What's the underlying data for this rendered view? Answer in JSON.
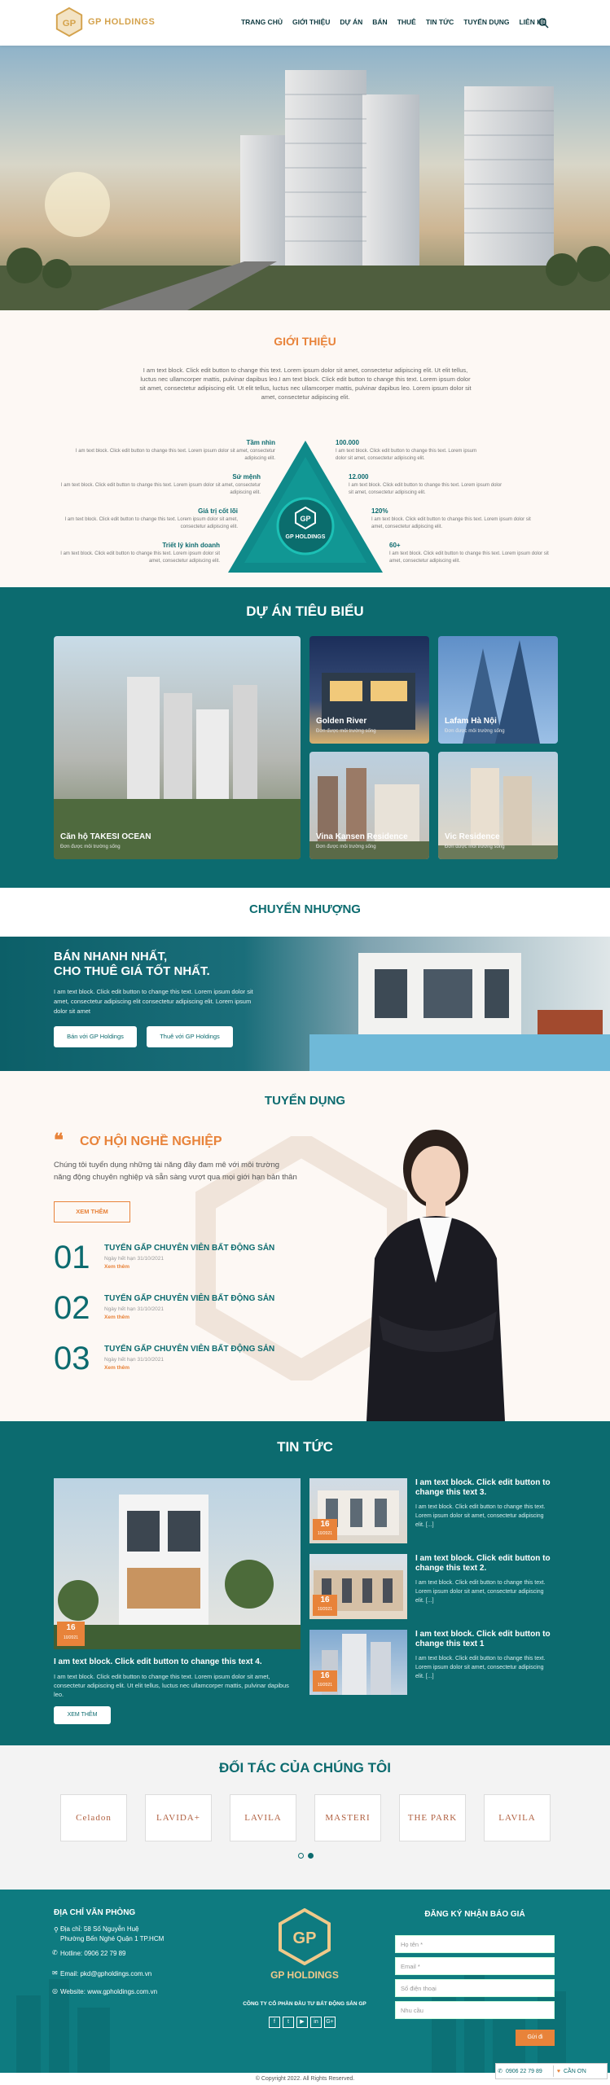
{
  "header": {
    "logo_text": "GP HOLDINGS",
    "nav": [
      "TRANG CHỦ",
      "GIỚI THIỆU",
      "DỰ ÁN",
      "BÁN",
      "THUÊ",
      "TIN TỨC",
      "TUYỂN DỤNG",
      "LIÊN HỆ"
    ]
  },
  "intro": {
    "title": "GIỚI THIỆU",
    "text": "I am text block. Click edit button to change this text. Lorem ipsum dolor sit amet, consectetur adipiscing elit. Ut elit tellus, luctus nec ullamcorper mattis, pulvinar dapibus leo.I am text block. Click edit button to change this text. Lorem ipsum dolor sit amet, consectetur adipiscing elit. Ut elit tellus, luctus nec ullamcorper mattis, pulvinar dapibus leo. Lorem ipsum dolor sit amet, consectetur adipiscing elit.",
    "left_items": [
      {
        "title": "Tầm nhìn",
        "text": "I am text block. Click edit button to change this text. Lorem ipsum dolor sit amet, consectetur adipiscing elit."
      },
      {
        "title": "Sứ mệnh",
        "text": "I am text block. Click edit button to change this text. Lorem ipsum dolor sit amet, consectetur adipiscing elit."
      },
      {
        "title": "Giá trị cốt lõi",
        "text": "I am text block. Click edit button to change this text. Lorem ipsum dolor sit amet, consectetur adipiscing elit."
      },
      {
        "title": "Triết lý kinh doanh",
        "text": "I am text block. Click edit button to change this text. Lorem ipsum dolor sit amet, consectetur adipiscing elit."
      }
    ],
    "right_items": [
      {
        "title": "100.000",
        "text": "I am text block. Click edit button to change this text. Lorem ipsum dolor sit amet, consectetur adipiscing elit."
      },
      {
        "title": "12.000",
        "text": "I am text block. Click edit button to change this text. Lorem ipsum dolor sit amet, consectetur adipiscing elit."
      },
      {
        "title": "120%",
        "text": "I am text block. Click edit button to change this text. Lorem ipsum dolor sit amet, consectetur adipiscing elit."
      },
      {
        "title": "60+",
        "text": "I am text block. Click edit button to change this text. Lorem ipsum dolor sit amet, consectetur adipiscing elit."
      }
    ],
    "center_logo_text": "GP HOLDINGS"
  },
  "projects": {
    "title": "DỰ ÁN TIÊU BIỂU",
    "items": [
      {
        "name": "Căn hộ TAKESI OCEAN",
        "sub": "Đơn được môi trường sống"
      },
      {
        "name": "Golden River",
        "sub": "Đơn được môi trường sống"
      },
      {
        "name": "Lafam Hà Nội",
        "sub": "Đơn được môi trường sống"
      },
      {
        "name": "Vina Kansen Residence",
        "sub": "Đơn được môi trường sống"
      },
      {
        "name": "Vic Residence",
        "sub": "Đơn được môi trường sống"
      }
    ]
  },
  "transfer": {
    "title": "CHUYỂN NHƯỢNG",
    "headline1": "BÁN NHANH NHẤT,",
    "headline2": "CHO THUÊ GIÁ TỐT NHẤT.",
    "text": "I am text block. Click edit button to change this text. Lorem ipsum dolor sit amet, consectetur adipiscing elit consectetur adipiscing elit. Lorem ipsum dolor sit amet",
    "btn_sell": "Bán với GP Holdings",
    "btn_rent": "Thuê với GP Holdings"
  },
  "recruit": {
    "title": "TUYỂN DỤNG",
    "subtitle": "CƠ HỘI NGHỀ NGHIỆP",
    "text": "Chúng tôi tuyển dụng những tài năng đầy đam mê với môi trường năng động chuyên nghiệp và sẵn sàng vượt qua mọi giới hạn bản thân",
    "more_btn": "XEM THÊM",
    "jobs": [
      {
        "num": "01",
        "title": "TUYỂN GẤP CHUYÊN VIÊN BẤT ĐỘNG SẢN",
        "date": "Ngày hết hạn 31/10/2021",
        "more": "Xem thêm"
      },
      {
        "num": "02",
        "title": "TUYỂN GẤP CHUYÊN VIÊN BẤT ĐỘNG SẢN",
        "date": "Ngày hết hạn 31/10/2021",
        "more": "Xem thêm"
      },
      {
        "num": "03",
        "title": "TUYỂN GẤP CHUYÊN VIÊN BẤT ĐỘNG SẢN",
        "date": "Ngày hết hạn 31/10/2021",
        "more": "Xem thêm"
      }
    ]
  },
  "news": {
    "title": "TIN TỨC",
    "main": {
      "day": "16",
      "month": "10/2021",
      "title": "I am text block. Click edit button to change this text 4.",
      "text": "I am text block. Click edit button to change this text. Lorem ipsum dolor sit amet, consectetur adipiscing elit. Ut elit tellus, luctus nec ullamcorper mattis, pulvinar dapibus leo.",
      "btn": "XEM THÊM"
    },
    "items": [
      {
        "day": "16",
        "month": "10/2021",
        "title": "I am text block. Click edit button to change this text 3.",
        "text": "I am text block. Click edit button to change this text. Lorem ipsum dolor sit amet, consectetur adipiscing elit. [...]"
      },
      {
        "day": "16",
        "month": "10/2021",
        "title": "I am text block. Click edit button to change this text 2.",
        "text": "I am text block. Click edit button to change this text. Lorem ipsum dolor sit amet, consectetur adipiscing elit. [...]"
      },
      {
        "day": "16",
        "month": "10/2021",
        "title": "I am text block. Click edit button to change this text 1",
        "text": "I am text block. Click edit button to change this text. Lorem ipsum dolor sit amet, consectetur adipiscing elit. [...]"
      }
    ]
  },
  "partners": {
    "title": "ĐỐI TÁC CỦA CHÚNG TÔI",
    "logos": [
      "Celadon",
      "LAVIDA+",
      "LAVILA",
      "MASTERI",
      "THE PARK",
      "LAVILA"
    ]
  },
  "footer": {
    "office_title": "ĐỊA CHỈ VĂN PHÒNG",
    "address1": "Địa chỉ: 58 Số Nguyễn Huệ",
    "address2": "Phường Bến Nghé Quận 1 TP.HCM",
    "hotline": "Hotline: 0906 22 79 89",
    "email": "Email: pkd@gpholdings.com.vn",
    "website": "Website: www.gpholdings.com.vn",
    "logo_text": "GP HOLDINGS",
    "company": "CÔNG TY CỔ PHẦN ĐẦU TƯ BẤT ĐỘNG SẢN GP",
    "social": [
      "f",
      "t",
      "▶",
      "in",
      "G+"
    ],
    "form_title": "ĐĂNG KÝ NHẬN BÁO GIÁ",
    "placeholders": {
      "name": "Họ tên *",
      "email": "Email *",
      "phone": "Số điện thoại",
      "need": "Nhu cầu"
    },
    "submit": "Gửi đi"
  },
  "copyright": "© Copyright 2022. All Rights Reserved.",
  "floating": {
    "phone": "0906 22 79 89",
    "chat": "CẦN ƠN"
  },
  "colors": {
    "primary": "#0c6b6f",
    "accent": "#e8833a",
    "gold": "#d4a24c"
  }
}
